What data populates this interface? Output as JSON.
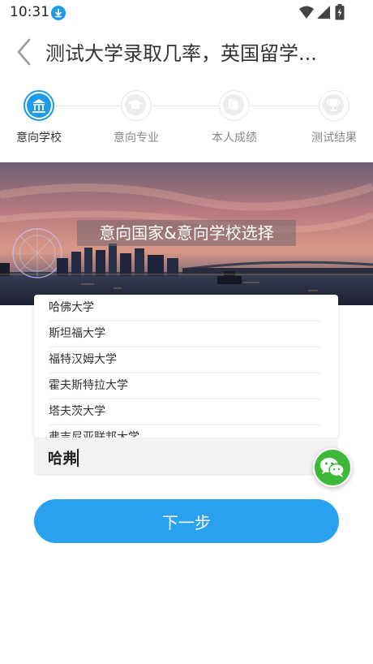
{
  "status_bar": {
    "time": "10:31",
    "icons": [
      "download-icon",
      "wifi-icon",
      "signal-icon",
      "battery-icon"
    ]
  },
  "header": {
    "title": "测试大学录取几率，英国留学..."
  },
  "steps": [
    {
      "label": "意向学校",
      "icon": "bank-icon",
      "active": true
    },
    {
      "label": "意向专业",
      "icon": "graduation-cap-icon",
      "active": false
    },
    {
      "label": "本人成绩",
      "icon": "document-icon",
      "active": false
    },
    {
      "label": "测试结果",
      "icon": "trophy-icon",
      "active": false
    }
  ],
  "banner": {
    "title": "意向国家&意向学校选择"
  },
  "dropdown": {
    "items": [
      "哈佛大学",
      "斯坦福大学",
      "福特汉姆大学",
      "霍夫斯特拉大学",
      "塔夫茨大学",
      "弗吉尼亚联邦大学"
    ]
  },
  "search": {
    "value": "哈弗"
  },
  "next_button": {
    "label": "下一步"
  },
  "colors": {
    "accent": "#2aa0f0",
    "wechat": "#3eb839"
  }
}
